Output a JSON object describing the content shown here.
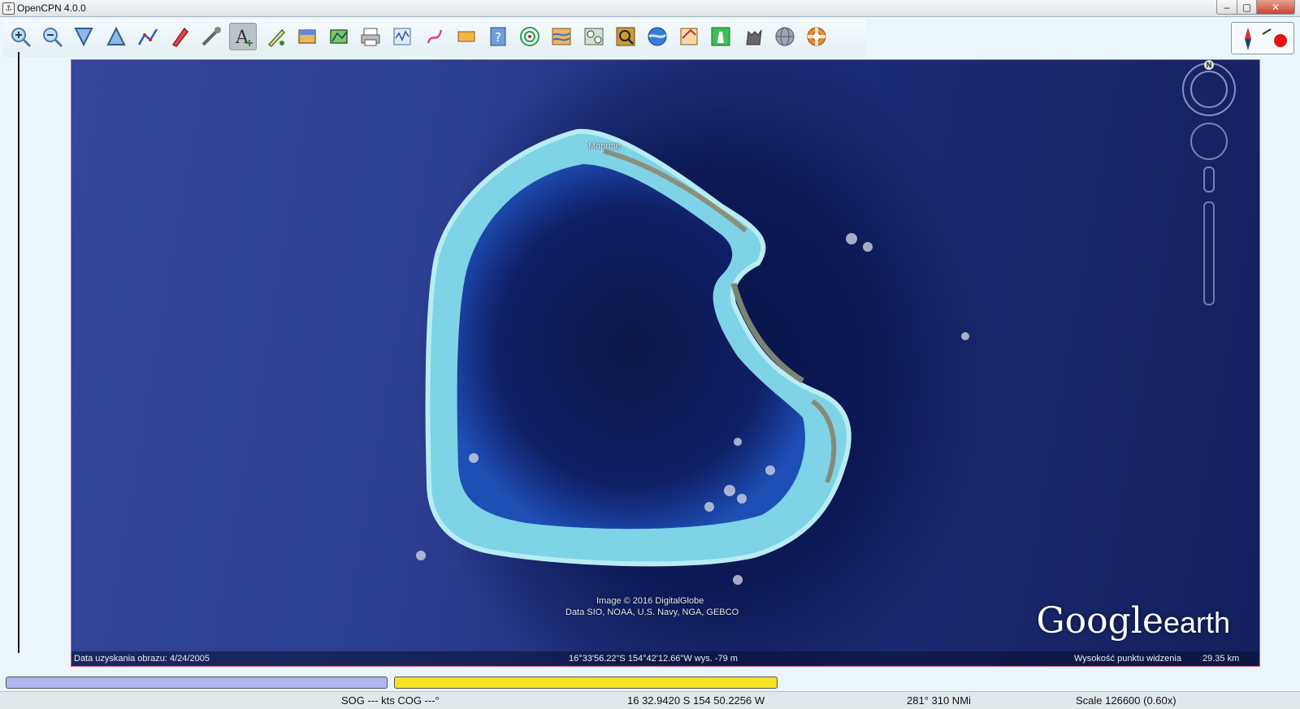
{
  "window": {
    "title": "OpenCPN 4.0.0",
    "min_glyph": "–",
    "max_glyph": "▢",
    "close_glyph": "✕"
  },
  "toolbar": {
    "buttons": [
      {
        "name": "zoom-in"
      },
      {
        "name": "zoom-out"
      },
      {
        "name": "scale-in"
      },
      {
        "name": "scale-out"
      },
      {
        "name": "route"
      },
      {
        "name": "auto-follow-ship"
      },
      {
        "name": "settings"
      },
      {
        "name": "text-toggle",
        "active": true
      },
      {
        "name": "mark-add"
      },
      {
        "name": "chart-pan"
      },
      {
        "name": "route-manager"
      },
      {
        "name": "print"
      },
      {
        "name": "tides"
      },
      {
        "name": "track"
      },
      {
        "name": "color-scheme"
      },
      {
        "name": "help"
      },
      {
        "name": "radar"
      },
      {
        "name": "weather-grib"
      },
      {
        "name": "dashboard"
      },
      {
        "name": "chart-search"
      },
      {
        "name": "google-earth"
      },
      {
        "name": "logbook"
      },
      {
        "name": "lighthouse"
      },
      {
        "name": "husky"
      },
      {
        "name": "globe"
      },
      {
        "name": "lifebuoy"
      }
    ]
  },
  "map": {
    "place_label": "Manuae",
    "credits_line1": "Image © 2016 DigitalGlobe",
    "credits_line2": "Data SIO, NOAA, U.S. Navy, NGA, GEBCO",
    "logo_google": "Google",
    "logo_earth": "earth",
    "compass_n": "N",
    "capture_date": "Data uzyskania obrazu: 4/24/2005",
    "coords": "16°33'56.22\"S 154°42'12.66\"W wys. -79 m",
    "eye_alt_label": "Wysokość punktu widzenia",
    "eye_alt_value": "29.35 km"
  },
  "status": {
    "sog_cog": "SOG --- kts COG ---°",
    "position": "16 32.9420 S   154 50.2256 W",
    "bearing": "281°  310 NMi",
    "scale": "Scale 126600 (0.60x)"
  },
  "colors": {
    "progress_one": "#b4b6f0",
    "progress_two": "#f4e323",
    "chart_border": "#c96080"
  }
}
